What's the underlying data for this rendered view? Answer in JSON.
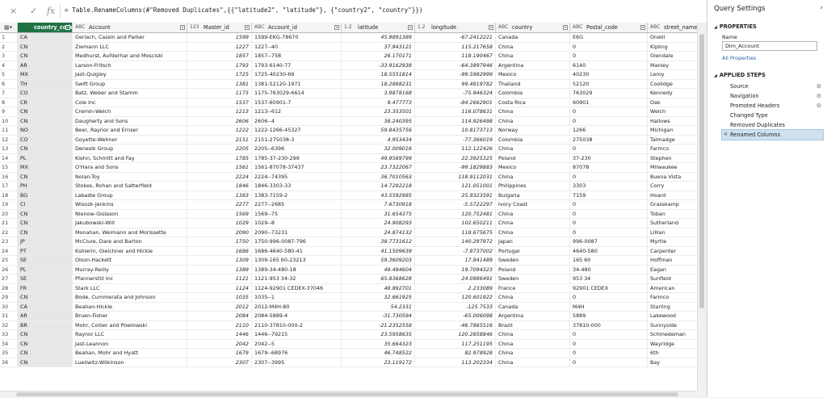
{
  "formula_bar": {
    "cancel_icon": "×",
    "commit_icon": "✓",
    "fx_label": "fx",
    "formula": "= Table.RenameColumns(#\"Removed Duplicates\",{{\"latitude2\", \"latitude\"}, {\"country2\", \"country\"}})"
  },
  "columns": [
    {
      "label": "country_code",
      "type_icon": "",
      "selected": true
    },
    {
      "label": "Account",
      "type_icon": "ABC"
    },
    {
      "label": "Master_id",
      "type_icon": "123"
    },
    {
      "label": "Account_id",
      "type_icon": "ABC"
    },
    {
      "label": "latitude",
      "type_icon": "1.2"
    },
    {
      "label": "longitude",
      "type_icon": "1.2"
    },
    {
      "label": "country",
      "type_icon": "ABC"
    },
    {
      "label": "Postal_code",
      "type_icon": "ABC"
    },
    {
      "label": "street_name",
      "type_icon": "ABC"
    }
  ],
  "rows": [
    [
      "1",
      "CA",
      "Gerlach, Cassin and Parker",
      "1599",
      "1599-EKG-78670",
      "45.9891389",
      "-67.2412221",
      "Canada",
      "E6G",
      "Oneill"
    ],
    [
      "2",
      "CN",
      "Ziemann LLC",
      "1227",
      "1227--40",
      "37.943121",
      "115.217658",
      "China",
      "0",
      "Kipling"
    ],
    [
      "3",
      "CN",
      "Medhurst, Aufderhar and Mosciski",
      "1857",
      "1857--758",
      "26.170171",
      "118.190467",
      "China",
      "0",
      "Glendale"
    ],
    [
      "4",
      "AR",
      "Larson-Fritsch",
      "1793",
      "1793-6140-77",
      "-33.9162938",
      "-64.3897946",
      "Argentina",
      "6140",
      "Manley"
    ],
    [
      "5",
      "MX",
      "Jast-Quigley",
      "1725",
      "1725-40230-69",
      "18.5551814",
      "-99.5982999",
      "Mexico",
      "40230",
      "Leroy"
    ],
    [
      "6",
      "TH",
      "Swift Group",
      "1381",
      "1381-52120-1971",
      "18.2868231",
      "99.4819782",
      "Thailand",
      "52120",
      "Coolidge"
    ],
    [
      "7",
      "CO",
      "Batz, Weber and Stamm",
      "1175",
      "1175-763029-6614",
      "3.9878168",
      "-75.946324",
      "Colombia",
      "763029",
      "Kennedy"
    ],
    [
      "8",
      "CR",
      "Cole Inc",
      "1537",
      "1537-60901-7",
      "9.477773",
      "-84.2662901",
      "Costa Rica",
      "60901",
      "Oak"
    ],
    [
      "9",
      "CN",
      "Cremin-Welch",
      "1213",
      "1213--612",
      "23.353501",
      "116.078631",
      "China",
      "0",
      "Welch"
    ],
    [
      "10",
      "CN",
      "Daugherty and Sons",
      "2606",
      "2606--4",
      "38.240395",
      "114.926498",
      "China",
      "0",
      "Hallows"
    ],
    [
      "11",
      "NO",
      "Beer, Raynor and Ernser",
      "1222",
      "1222-1266-45327",
      "59.8435756",
      "10.8173713",
      "Norway",
      "1266",
      "Michigan"
    ],
    [
      "12",
      "CO",
      "Goyette-Wehner",
      "2151",
      "2151-275038-3",
      "4.953434",
      "-77.366019",
      "Colombia",
      "275038",
      "Talmadge"
    ],
    [
      "13",
      "CN",
      "Denesik Group",
      "2205",
      "2205--6396",
      "32.009016",
      "112.122426",
      "China",
      "0",
      "Farmco"
    ],
    [
      "14",
      "PL",
      "Kiehn, Schmitt and Fay",
      "1785",
      "1785-37-230-299",
      "49.9569799",
      "22.3925325",
      "Poland",
      "37-230",
      "Stephen"
    ],
    [
      "15",
      "MX",
      "O'Hara and Sons",
      "1561",
      "1561-87078-37437",
      "23.7322067",
      "-99.1829883",
      "Mexico",
      "87078",
      "Milwaukee"
    ],
    [
      "16",
      "CN",
      "Nolan-Toy",
      "2224",
      "2224--74395",
      "36.7010563",
      "118.9112031",
      "China",
      "0",
      "Buena Vista"
    ],
    [
      "17",
      "PH",
      "Stokes, Rohan and Satterfield",
      "1846",
      "1846-3303-33",
      "14.7292218",
      "121.051001",
      "Philippines",
      "3303",
      "Corry"
    ],
    [
      "18",
      "BG",
      "Labadie Group",
      "1383",
      "1383-7159-2",
      "43.5592985",
      "25.9323591",
      "Bulgaria",
      "7159",
      "Hoard"
    ],
    [
      "19",
      "CI",
      "Wisozk-Jenkins",
      "2277",
      "2277--2685",
      "7.6730918",
      "-5.5722297",
      "Ivory Coast",
      "0",
      "Grasskamp"
    ],
    [
      "20",
      "CN",
      "Nienow-Gislason",
      "1569",
      "1569--75",
      "31.654375",
      "120.752481",
      "China",
      "0",
      "Toban"
    ],
    [
      "21",
      "CN",
      "Jakubowski-Will",
      "1029",
      "1029--8",
      "24.908293",
      "102.650211",
      "China",
      "0",
      "Sutherland"
    ],
    [
      "22",
      "CN",
      "Monahan, Weimann and Morissette",
      "2090",
      "2090--73231",
      "24.874132",
      "118.675675",
      "China",
      "0",
      "Lillian"
    ],
    [
      "23",
      "JP",
      "McClure, Dare and Barton",
      "1750",
      "1750-996-0087-796",
      "38.7731612",
      "140.297972",
      "Japan",
      "996-0087",
      "Myrtle"
    ],
    [
      "24",
      "PT",
      "Kshlerin, Gleichner and Hickle",
      "1686",
      "1686-4640-580-41",
      "41.1509639",
      "-7.9737002",
      "Portugal",
      "4640-580",
      "Carpenter"
    ],
    [
      "25",
      "SE",
      "Olson-Hackett",
      "1309",
      "1309-165 60-23213",
      "59.3609203",
      "17.841489",
      "Sweden",
      "165 60",
      "Hoffman"
    ],
    [
      "26",
      "PL",
      "Murray-Reilly",
      "1389",
      "1389-34-480-18",
      "49.494604",
      "19.7094323",
      "Poland",
      "34-480",
      "Eagan"
    ],
    [
      "27",
      "SE",
      "Pfannerstill Inc",
      "1121",
      "1121-953 34-32",
      "65.8368628",
      "24.0986491",
      "Sweden",
      "953 34",
      "Sunfield"
    ],
    [
      "28",
      "FR",
      "Stark LLC",
      "1124",
      "1124-92901 CEDEX-37046",
      "48.892701",
      "2.233089",
      "France",
      "92901 CEDEX",
      "American"
    ],
    [
      "29",
      "CN",
      "Bode, Cummerata and Johnson",
      "1035",
      "1035--1",
      "32.661925",
      "120.601922",
      "China",
      "0",
      "Farmco"
    ],
    [
      "30",
      "CA",
      "Beahan-Hickle",
      "2012",
      "2012-M4H-80",
      "54.2331",
      "-125.7533",
      "Canada",
      "M4H",
      "Starling"
    ],
    [
      "31",
      "AR",
      "Bruen-Fisher",
      "2084",
      "2084-5889-4",
      "-31.730594",
      "-65.006098",
      "Argentina",
      "5889",
      "Lakewood"
    ],
    [
      "32",
      "BR",
      "Mohr, Collier and Powlowski",
      "2110",
      "2110-37810-000-2",
      "-21.2352558",
      "-46.7865516",
      "Brazil",
      "37810-000",
      "Sunnyside"
    ],
    [
      "33",
      "CN",
      "Raynor LLC",
      "1446",
      "1446--79215",
      "23.5958635",
      "120.2858846",
      "China",
      "0",
      "Schmedeman"
    ],
    [
      "34",
      "CN",
      "Jast-Leannon",
      "2042",
      "2042--5",
      "35.664323",
      "117.251195",
      "China",
      "0",
      "Wayridge"
    ],
    [
      "35",
      "CN",
      "Beahan, Mohr and Hyatt",
      "1679",
      "1679--68976",
      "46.748522",
      "82.978928",
      "China",
      "0",
      "6th"
    ],
    [
      "36",
      "CN",
      "Lueilwitz-Wilkinson",
      "2307",
      "2307--3995",
      "23.119172",
      "113.202334",
      "China",
      "0",
      "Bay"
    ]
  ],
  "panel": {
    "title": "Query Settings",
    "collapse_icon": "›",
    "properties_heading": "PROPERTIES",
    "name_label": "Name",
    "name_value": "Dim_Account",
    "all_properties_link": "All Properties",
    "steps_heading": "APPLIED STEPS",
    "steps": [
      {
        "label": "Source",
        "gear": true
      },
      {
        "label": "Navigation",
        "gear": true
      },
      {
        "label": "Promoted Headers",
        "gear": true
      },
      {
        "label": "Changed Type",
        "gear": false
      },
      {
        "label": "Removed Duplicates",
        "gear": false
      },
      {
        "label": "Renamed Columns",
        "gear": false,
        "active": true
      }
    ]
  }
}
